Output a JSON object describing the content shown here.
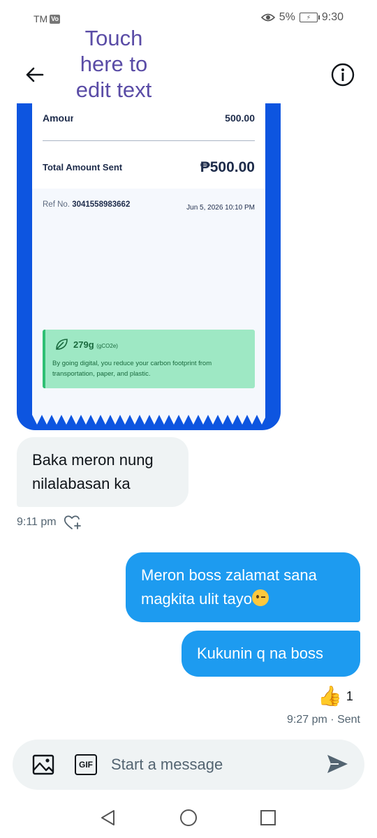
{
  "status_bar": {
    "carrier": "TM",
    "carrier_badge": "Vo",
    "battery_percent": "5%",
    "time": "9:30"
  },
  "header": {
    "edit_text_overlay": "Touch here to edit text"
  },
  "receipt": {
    "amount_label": "Amount",
    "amount_value": "500.00",
    "total_label": "Total Amount Sent",
    "total_value": "₱500.00",
    "ref_label": "Ref No.",
    "ref_number": "3041558983662",
    "date": "Jun 5, 2026 10:10 PM",
    "carbon_value": "279g",
    "carbon_unit": "(gCO2e)",
    "carbon_text": "By going digital, you reduce your carbon footprint from transportation, paper, and plastic."
  },
  "messages": {
    "incoming": [
      {
        "text": "Baka meron nung nilalabasan ka",
        "time": "9:11 pm"
      }
    ],
    "outgoing": [
      {
        "text": "Meron boss zalamat sana magkita ulit tayo"
      },
      {
        "text": "Kukunin q na boss"
      }
    ],
    "reaction_count": "1",
    "sent_status": "9:27 pm · Sent"
  },
  "composer": {
    "gif_label": "GIF",
    "placeholder": "Start a message"
  },
  "icons": {
    "back": "arrow-left-icon",
    "info": "info-circle-icon",
    "media": "image-icon",
    "send": "send-icon",
    "heart": "heart-plus-icon",
    "reaction": "thumbs-up-icon"
  },
  "colors": {
    "receipt_blue": "#0d55e0",
    "outgoing_bubble": "#1d9bf0",
    "incoming_bubble": "#eff3f4",
    "carbon_green": "#9ee8c4",
    "overlay_text": "#5a4ca6"
  }
}
